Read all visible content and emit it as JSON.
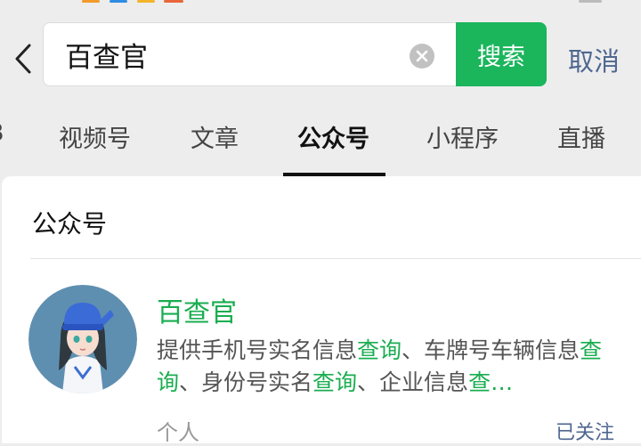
{
  "search": {
    "query": "百查官",
    "button_label": "搜索",
    "cancel_label": "取消"
  },
  "tabs": [
    {
      "label": "视频号",
      "active": false
    },
    {
      "label": "文章",
      "active": false
    },
    {
      "label": "公众号",
      "active": true
    },
    {
      "label": "小程序",
      "active": false
    },
    {
      "label": "直播",
      "active": false
    }
  ],
  "section": {
    "title": "公众号"
  },
  "result": {
    "name": "百查官",
    "description_parts": [
      {
        "text": "提供手机号实名信息",
        "highlight": false
      },
      {
        "text": "查询",
        "highlight": true
      },
      {
        "text": "、车牌号车辆信息",
        "highlight": false
      },
      {
        "text": "查询",
        "highlight": true
      },
      {
        "text": "、身份号实名",
        "highlight": false
      },
      {
        "text": "查询",
        "highlight": true
      },
      {
        "text": "、企业信息",
        "highlight": false
      },
      {
        "text": "查…",
        "highlight": true
      }
    ],
    "type": "个人",
    "follow_status": "已关注"
  },
  "colors": {
    "accent_green": "#1bb55c",
    "link_blue": "#4f6790",
    "background": "#ededed"
  },
  "icons": {
    "back": "chevron-left-icon",
    "clear": "clear-circle-icon"
  }
}
